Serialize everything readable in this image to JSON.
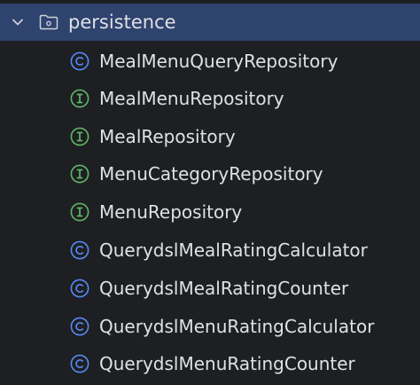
{
  "colors": {
    "background": "#1e1f22",
    "selection": "#2e436e",
    "text": "#dfe1e5",
    "class_icon": "#548af7",
    "interface_icon": "#5fb865",
    "folder_icon": "#ced0d6"
  },
  "tree": {
    "folder": {
      "label": "persistence",
      "expanded": true,
      "chevron_icon": "chevron-down-icon",
      "folder_icon": "package-folder-icon"
    },
    "items": [
      {
        "kind": "class",
        "icon": "class-icon",
        "label": "MealMenuQueryRepository"
      },
      {
        "kind": "interface",
        "icon": "interface-icon",
        "label": "MealMenuRepository"
      },
      {
        "kind": "interface",
        "icon": "interface-icon",
        "label": "MealRepository"
      },
      {
        "kind": "interface",
        "icon": "interface-icon",
        "label": "MenuCategoryRepository"
      },
      {
        "kind": "interface",
        "icon": "interface-icon",
        "label": "MenuRepository"
      },
      {
        "kind": "class",
        "icon": "class-icon",
        "label": "QuerydslMealRatingCalculator"
      },
      {
        "kind": "class",
        "icon": "class-icon",
        "label": "QuerydslMealRatingCounter"
      },
      {
        "kind": "class",
        "icon": "class-icon",
        "label": "QuerydslMenuRatingCalculator"
      },
      {
        "kind": "class",
        "icon": "class-icon",
        "label": "QuerydslMenuRatingCounter"
      }
    ]
  }
}
